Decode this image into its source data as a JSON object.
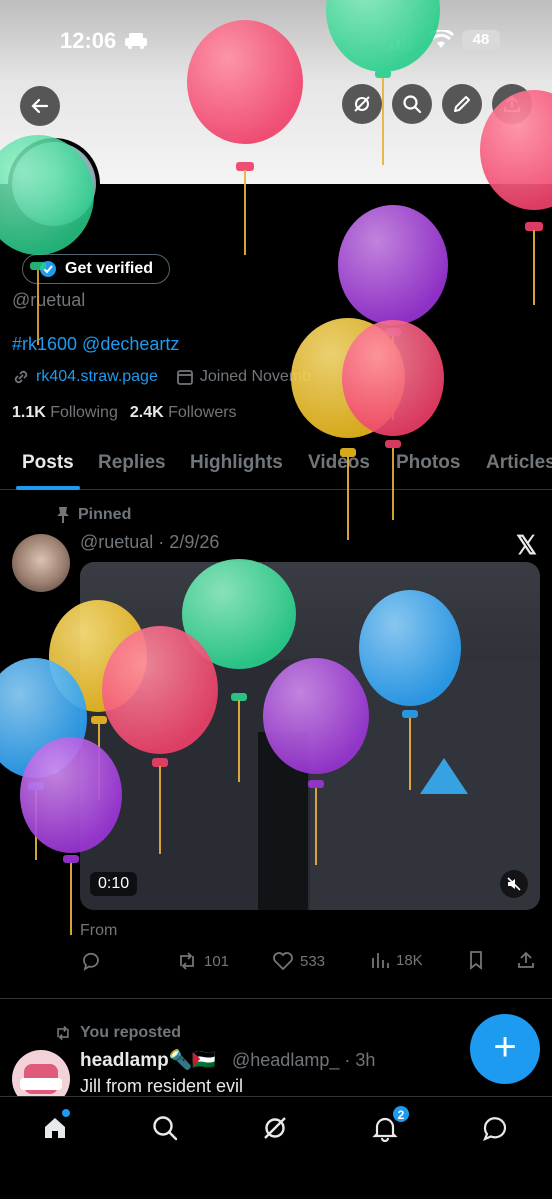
{
  "status_bar": {
    "time": "12:06",
    "battery": "48"
  },
  "profile": {
    "verify_label": "Get verified",
    "handle": "@ruetual",
    "bio": "#rk1600 @decheartz",
    "link": "rk404.straw.page",
    "joined": "Joined Novemb",
    "following_count": "1.1K",
    "following_label": "Following",
    "followers_count": "2.4K",
    "followers_label": "Followers"
  },
  "tabs": [
    "Posts",
    "Replies",
    "Highlights",
    "Videos",
    "Photos",
    "Articles"
  ],
  "pinned_post": {
    "pinned_label": "Pinned",
    "handle_date": "@ruetual · 2/9/26",
    "video_duration": "0:10",
    "from_label": "From",
    "reposts": "101",
    "likes": "533",
    "views": "18K"
  },
  "repost_post": {
    "repost_label": "You reposted",
    "name": "headlamp🔦🇵🇸",
    "handle_time": "@headlamp_ · 3h",
    "text": "Jill from resident evil"
  },
  "fab_label": "+",
  "nav": {
    "notifications_badge": "2"
  },
  "colors": {
    "accent": "#1d9bf0",
    "background": "#000000",
    "muted": "#71767b"
  }
}
